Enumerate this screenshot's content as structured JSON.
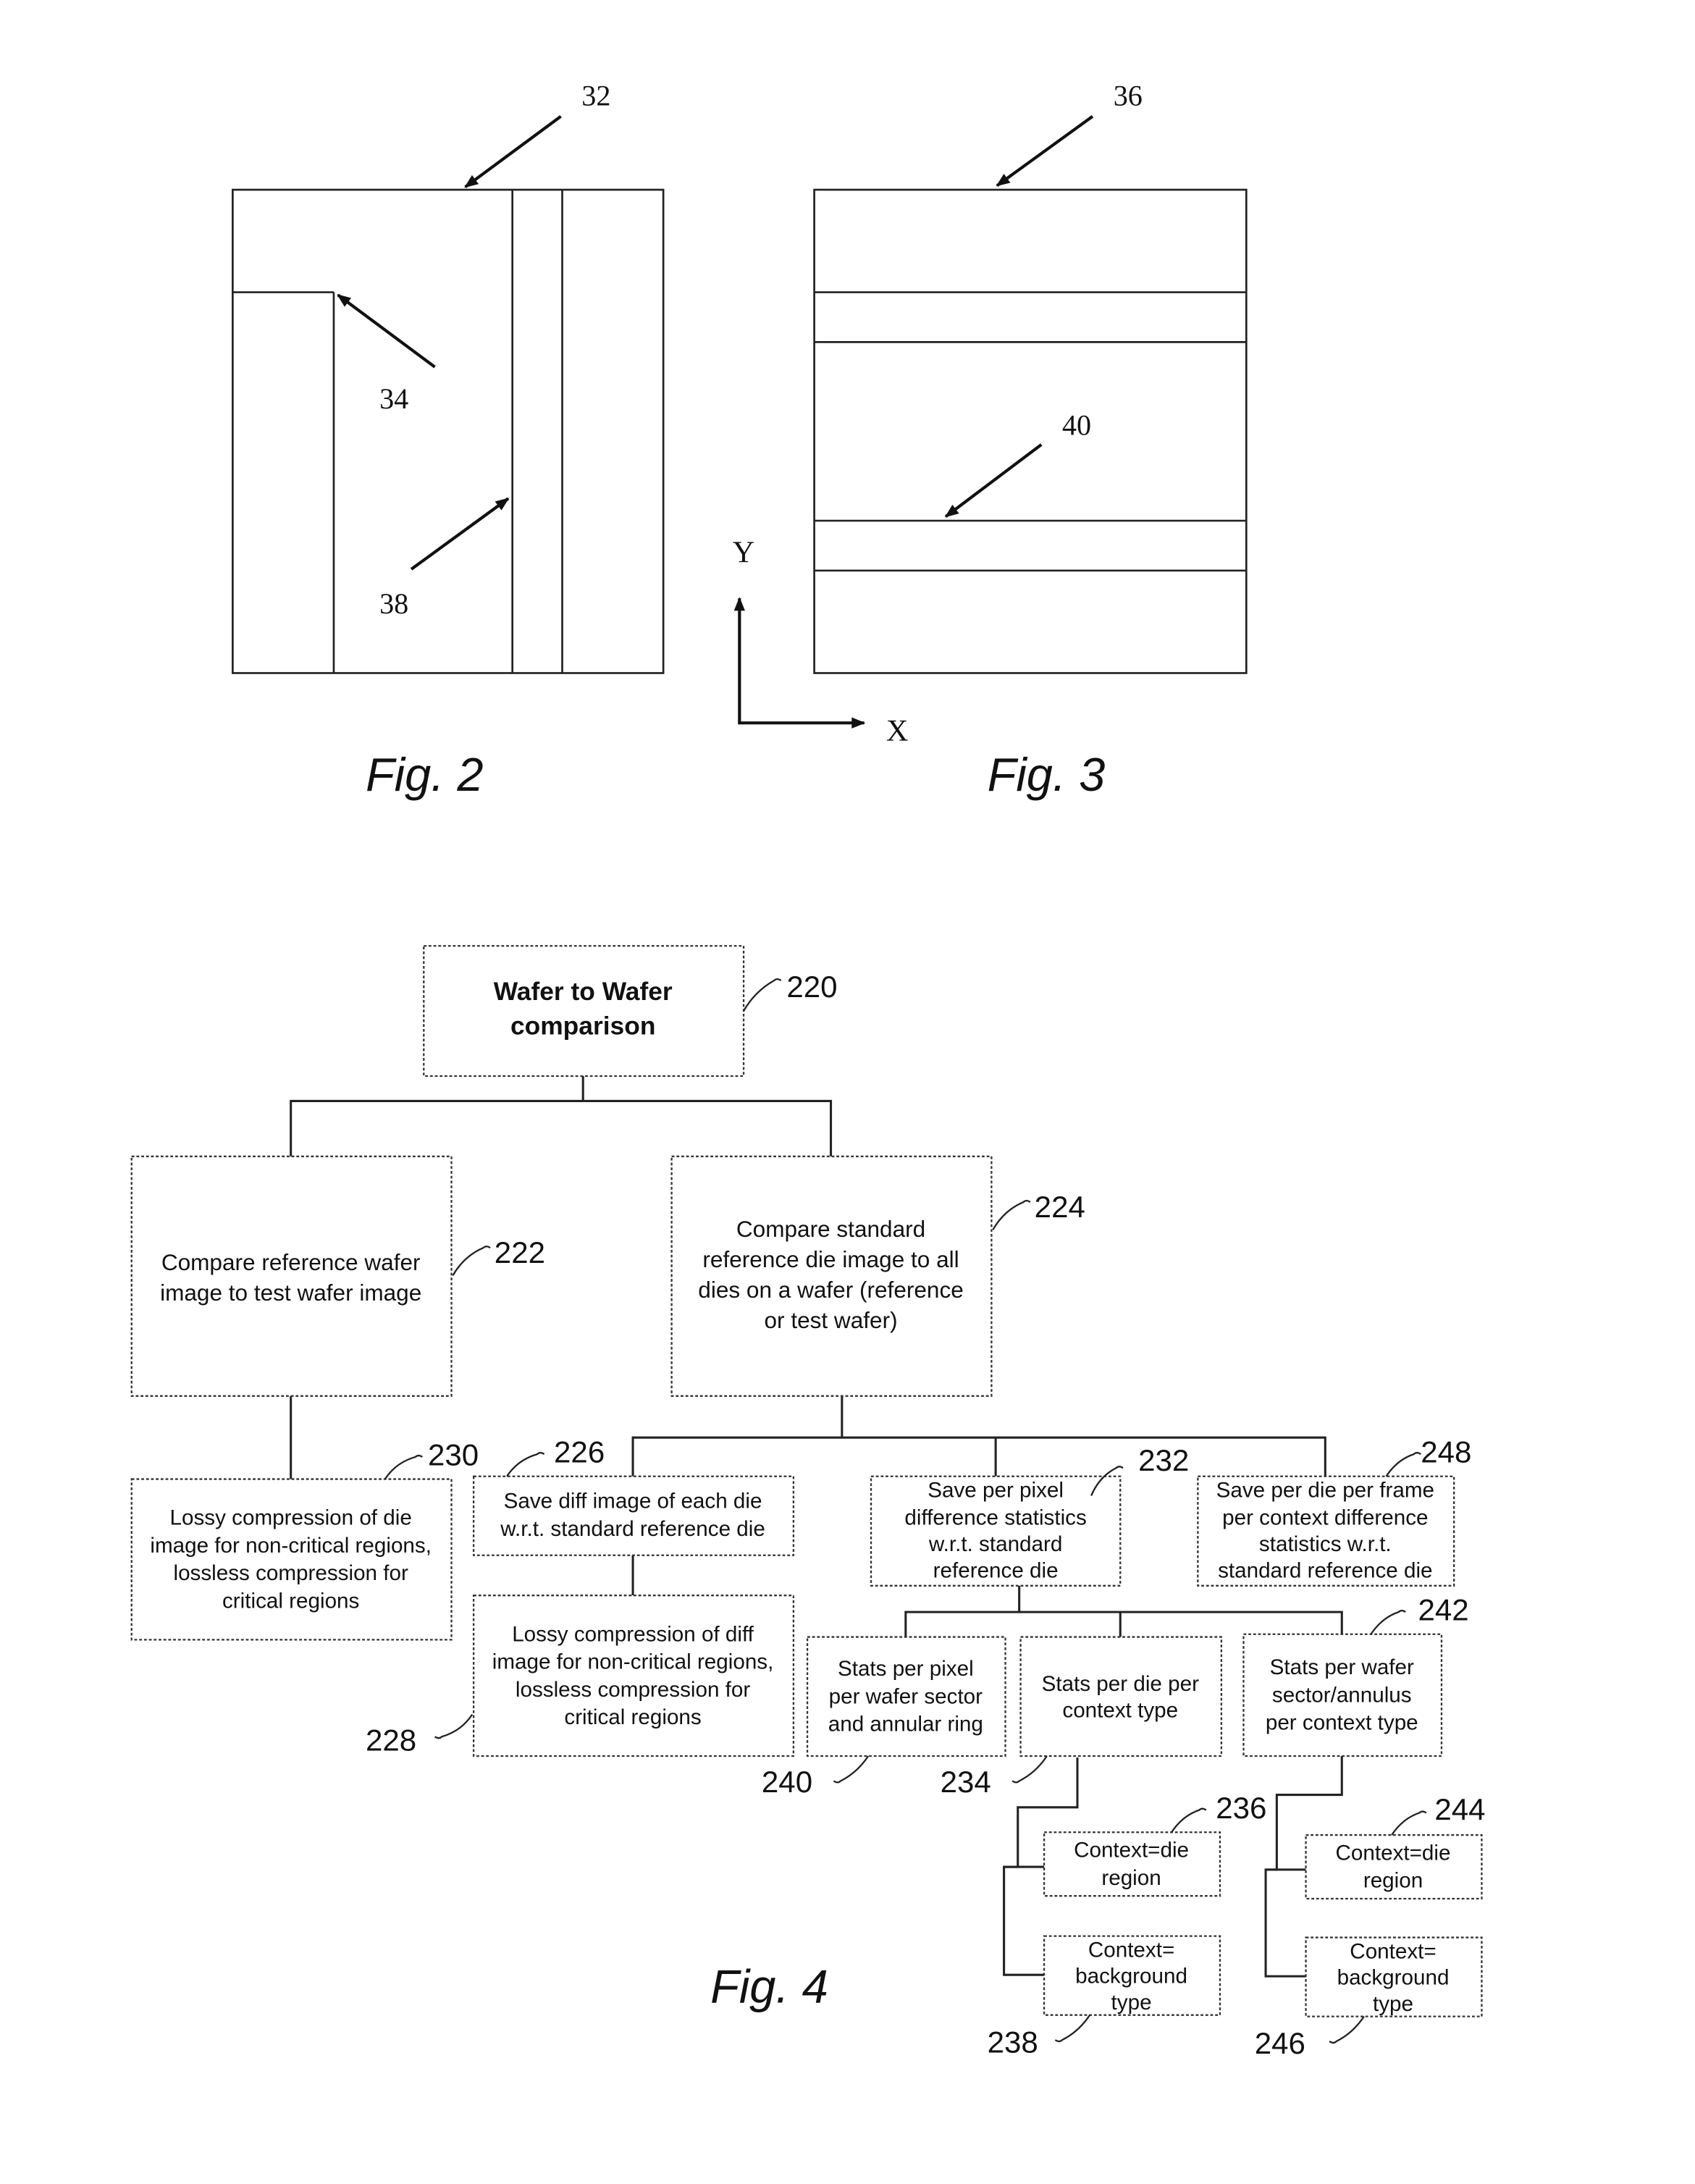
{
  "fig2": {
    "caption": "Fig. 2",
    "refs": {
      "outer": "32",
      "corner": "34",
      "edge": "38"
    }
  },
  "fig3": {
    "caption": "Fig. 3",
    "refs": {
      "outer": "36",
      "band": "40"
    },
    "axes": {
      "y": "Y",
      "x": "X"
    }
  },
  "fig4": {
    "caption": "Fig. 4",
    "nodes": {
      "n220": {
        "ref": "220",
        "lines": [
          "Wafer to Wafer",
          "comparison"
        ]
      },
      "n222": {
        "ref": "222",
        "lines": [
          "Compare reference wafer",
          "image to test wafer image"
        ]
      },
      "n224": {
        "ref": "224",
        "lines": [
          "Compare standard",
          "reference die image to all",
          "dies on a wafer (reference",
          "or test wafer)"
        ]
      },
      "n230": {
        "ref": "230",
        "lines": [
          "Lossy compression of die",
          "image for non-critical regions,",
          "lossless compression for",
          "critical regions"
        ]
      },
      "n226": {
        "ref": "226",
        "lines": [
          "Save diff image of each die",
          "w.r.t. standard reference die"
        ]
      },
      "n228": {
        "ref": "228",
        "lines": [
          "Lossy compression of diff",
          "image for non-critical regions,",
          "lossless compression for",
          "critical regions"
        ]
      },
      "n232": {
        "ref": "232",
        "lines": [
          "Save per pixel",
          "difference statistics",
          "w.r.t. standard",
          "reference die"
        ]
      },
      "n248": {
        "ref": "248",
        "lines": [
          "Save per die per frame",
          "per context difference",
          "statistics w.r.t.",
          "standard reference die"
        ]
      },
      "n240": {
        "ref": "240",
        "lines": [
          "Stats  per pixel",
          "per wafer sector",
          "and annular ring"
        ]
      },
      "n234": {
        "ref": "234",
        "lines": [
          "Stats per die per",
          "context type"
        ]
      },
      "n242": {
        "ref": "242",
        "lines": [
          "Stats per wafer",
          "sector/annulus",
          "per context type"
        ]
      },
      "n236": {
        "ref": "236",
        "lines": [
          "Context=die",
          "region"
        ]
      },
      "n238": {
        "ref": "238",
        "lines": [
          "Context=",
          "background",
          "type"
        ]
      },
      "n244": {
        "ref": "244",
        "lines": [
          "Context=die",
          "region"
        ]
      },
      "n246": {
        "ref": "246",
        "lines": [
          "Context=",
          "background",
          "type"
        ]
      }
    }
  }
}
